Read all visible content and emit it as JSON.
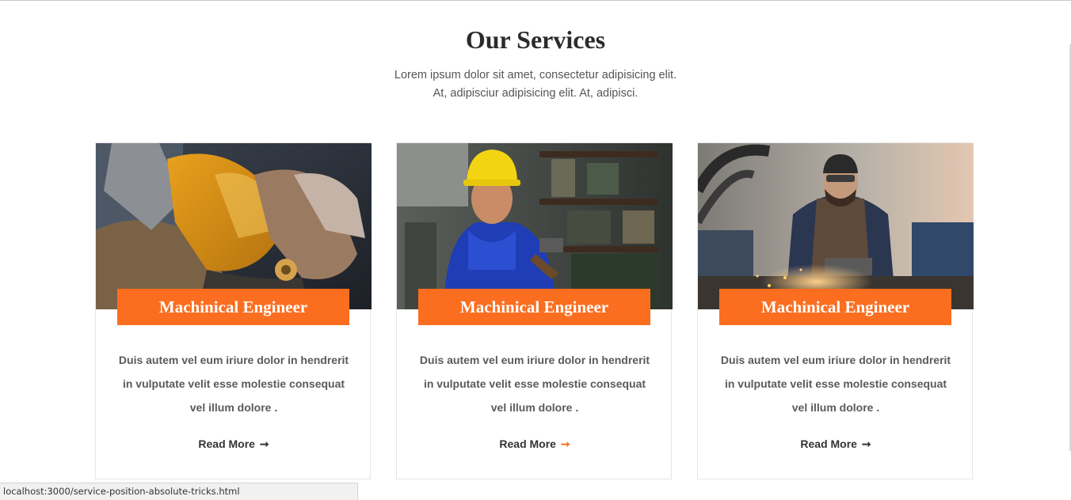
{
  "section": {
    "title": "Our Services",
    "subtitle_line1": "Lorem ipsum dolor sit amet, consectetur adipisicing elit.",
    "subtitle_line2": "At, adipisciur adipisicing elit. At, adipisci."
  },
  "cards": [
    {
      "image": "gloved-hands-grinder-photo",
      "label": "Machinical Engineer",
      "text": "Duis autem vel eum iriure dolor in hendrerit in vulputate velit esse molestie consequat vel illum dolore .",
      "link": "Read More",
      "arrow": "➞"
    },
    {
      "image": "worker-yellow-helmet-photo",
      "label": "Machinical Engineer",
      "text": "Duis autem vel eum iriure dolor in hendrerit in vulputate velit esse molestie consequat vel illum dolore .",
      "link": "Read More",
      "arrow": "➞"
    },
    {
      "image": "welder-grinding-sparks-photo",
      "label": "Machinical Engineer",
      "text": "Duis autem vel eum iriure dolor in hendrerit in vulputate velit esse molestie consequat vel illum dolore .",
      "link": "Read More",
      "arrow": "➞"
    }
  ],
  "status_bar": {
    "url": "localhost:3000/service-position-absolute-tricks.html"
  },
  "colors": {
    "accent": "#fb6e1f",
    "heading": "#2b2b2b",
    "body_text": "#5a5a5a"
  }
}
